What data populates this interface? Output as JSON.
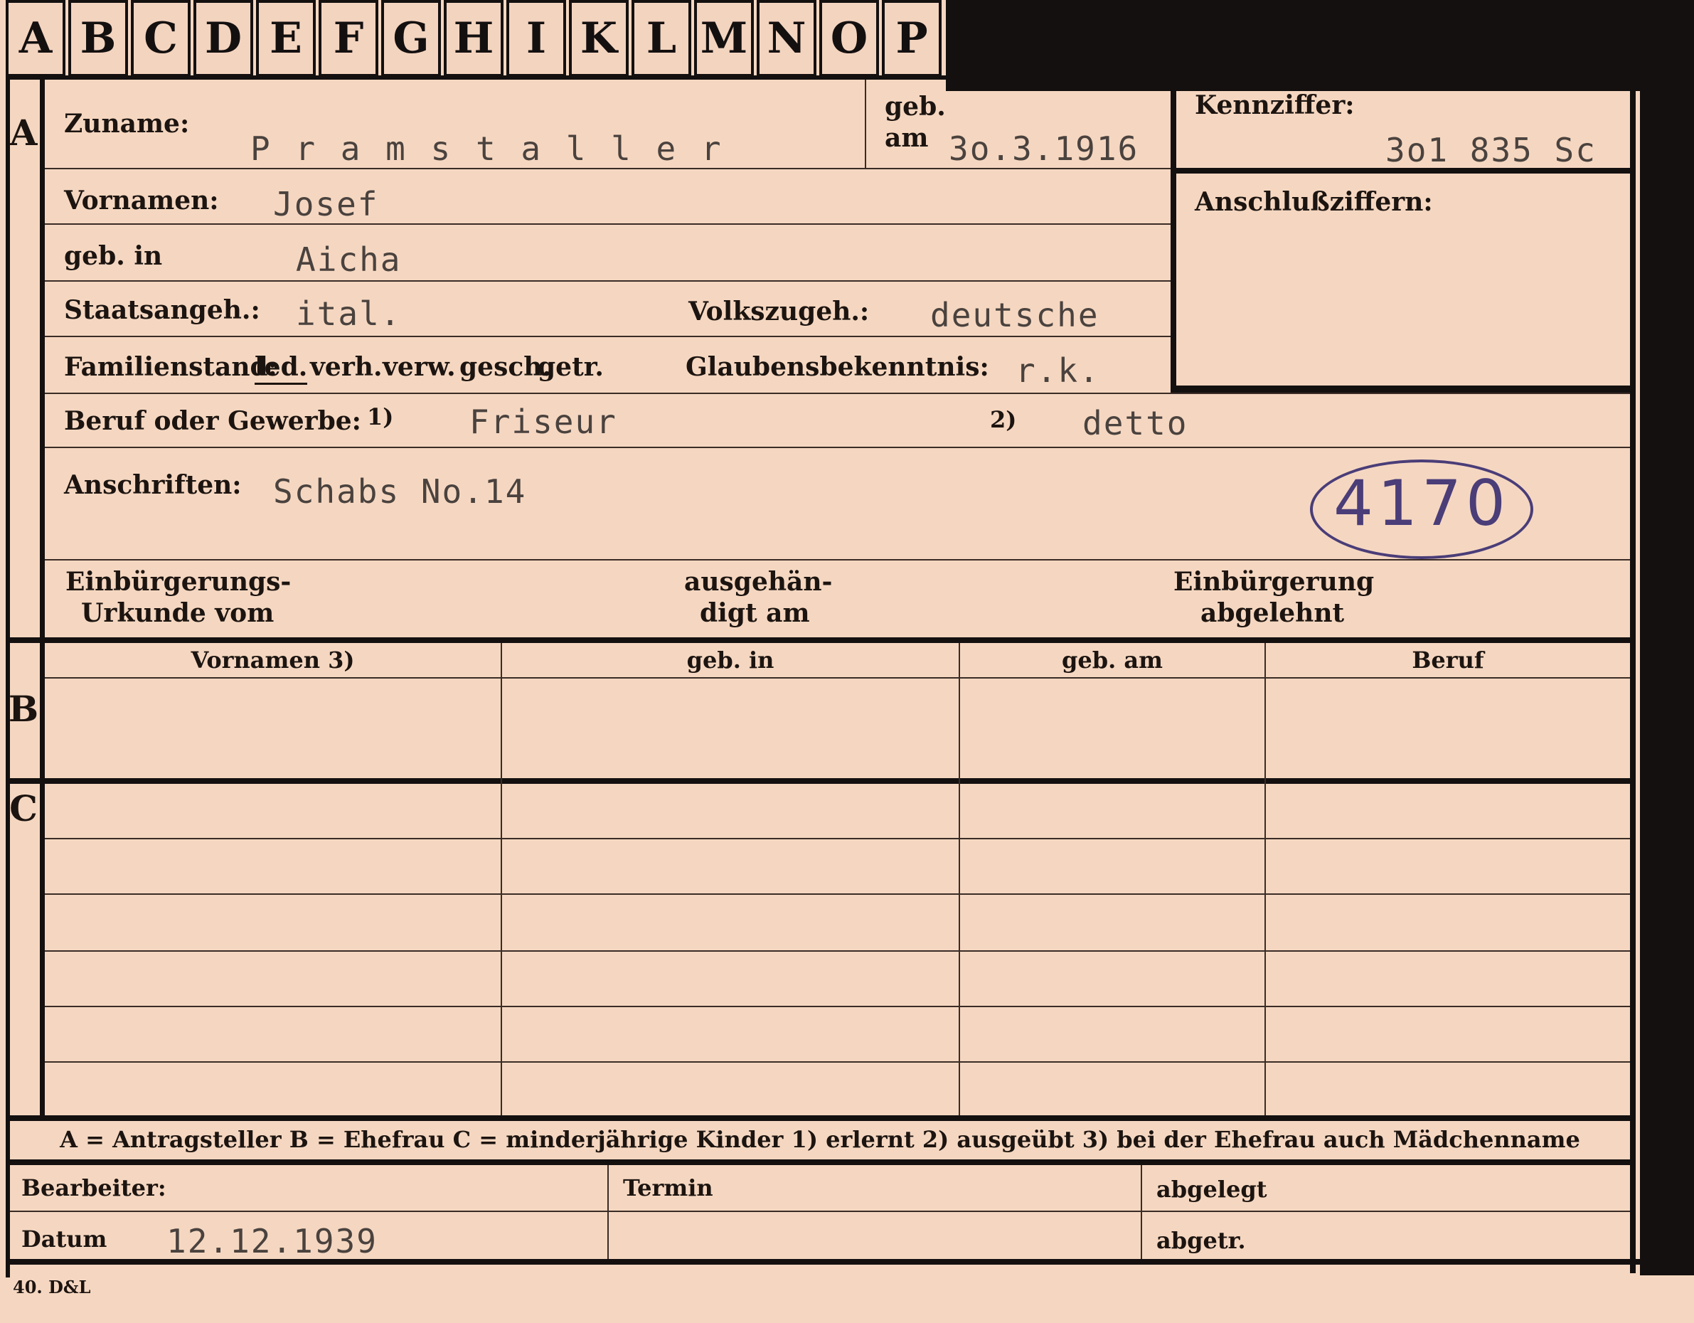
{
  "tabs": [
    "A",
    "B",
    "C",
    "D",
    "E",
    "F",
    "G",
    "H",
    "I",
    "K",
    "L",
    "M",
    "N",
    "O",
    "P"
  ],
  "section_letters": {
    "a": "A",
    "b": "B",
    "c": "C"
  },
  "labels": {
    "zuname": "Zuname:",
    "geb": "geb.",
    "am": "am",
    "kennziffer": "Kennziffer:",
    "vornamen": "Vornamen:",
    "anschlussziffern": "Anschlußziffern:",
    "geb_in": "geb. in",
    "staatsangeh": "Staatsangeh.:",
    "volkszugeh": "Volkszugeh.:",
    "familienstand": "Familienstand:",
    "familienstand_options": [
      "led.",
      "verh.",
      "verw.",
      "gesch.",
      "getr."
    ],
    "glaubensbekenntnis": "Glaubensbekenntnis:",
    "beruf": "Beruf oder Gewerbe:",
    "note1": "1)",
    "note2": "2)",
    "anschriften": "Anschriften:",
    "einbuergerungs_line1": "Einbürgerungs-",
    "einbuergerungs_line2": "Urkunde vom",
    "ausgehaendigt_line1": "ausgehän-",
    "ausgehaendigt_line2": "digt am",
    "abgelehnt_line1": "Einbürgerung",
    "abgelehnt_line2": "abgelehnt",
    "col_vornamen": "Vornamen 3)",
    "col_geb_in": "geb. in",
    "col_geb_am": "geb. am",
    "col_beruf": "Beruf",
    "legend": "A = Antragsteller   B = Ehefrau   C = minderjährige Kinder   1) erlernt   2) ausgeübt   3) bei der Ehefrau auch Mädchenname",
    "bearbeiter": "Bearbeiter:",
    "termin": "Termin",
    "abgelegt": "abgelegt",
    "datum": "Datum",
    "abgetr": "abgetr.",
    "printer": "40. D&L"
  },
  "values": {
    "zuname": "P r a m s t a l l e r",
    "geb_am": "3o.3.1916",
    "kennziffer": "3o1 835  Sc",
    "vornamen": "Josef",
    "geb_in": "Aicha",
    "staatsangeh": "ital.",
    "volkszugeh": "deutsche",
    "glaubensbekenntnis": "r.k.",
    "beruf_erlernt": "Friseur",
    "beruf_ausgeuebt": "detto",
    "anschrift": "Schabs No.14",
    "handwritten_number": "4170",
    "datum": "12.12.1939"
  },
  "colors": {
    "card": "#f5d7c1",
    "ink": "#141010",
    "typewriter": "#4a423e",
    "handwriting": "#4a3d78"
  }
}
